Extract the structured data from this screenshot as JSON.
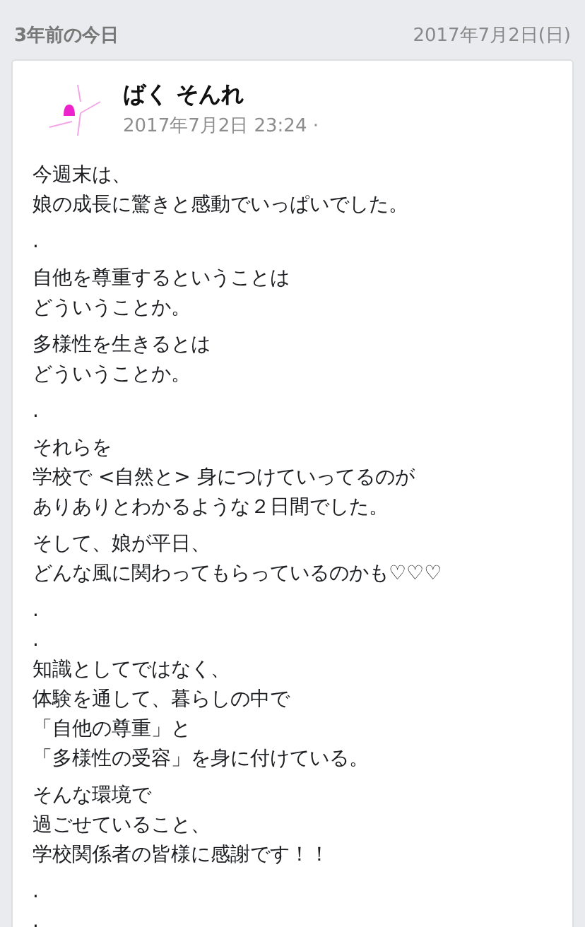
{
  "header": {
    "title": "3年前の今日",
    "date": "2017年7月2日(日)"
  },
  "post": {
    "author": "ばく そんれ",
    "timestamp": "2017年7月2日 23:24 ·",
    "paragraphs": [
      [
        "今週末は、",
        "娘の成長に驚きと感動でいっぱいでした。"
      ],
      [
        "."
      ],
      [
        "自他を尊重するということは",
        "どういうことか。"
      ],
      [
        "多様性を生きるとは",
        "どういうことか。"
      ],
      [
        "."
      ],
      [
        "それらを",
        "学校で <自然と> 身につけていってるのが",
        "ありありとわかるような２日間でした。"
      ],
      [
        "そして、娘が平日、",
        "どんな風に関わってもらっているのかも♡♡♡"
      ],
      [
        ".",
        ".",
        "知識としてではなく、",
        "体験を通して、暮らしの中で",
        "「自他の尊重」と",
        "「多様性の受容」を身に付けている。"
      ],
      [
        "そんな環境で",
        "過ごせていること、",
        "学校関係者の皆様に感謝です！！"
      ],
      [
        ".",
        "."
      ]
    ]
  }
}
